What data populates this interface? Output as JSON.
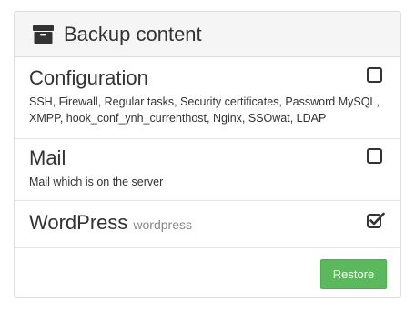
{
  "panel": {
    "title": "Backup content",
    "title_icon": "archive-icon"
  },
  "items": [
    {
      "name": "Configuration",
      "description": "SSH, Firewall, Regular tasks, Security certificates, Password MySQL, XMPP, hook_conf_ynh_currenthost, Nginx, SSOwat, LDAP",
      "checked": false
    },
    {
      "name": "Mail",
      "description": "Mail which is on the server",
      "checked": false
    },
    {
      "name": "WordPress",
      "sub": "wordpress",
      "checked": true
    }
  ],
  "actions": {
    "restore_label": "Restore"
  },
  "colors": {
    "button": "#5cb85c",
    "heading_bg": "#f5f5f5",
    "border": "#dddddd"
  }
}
